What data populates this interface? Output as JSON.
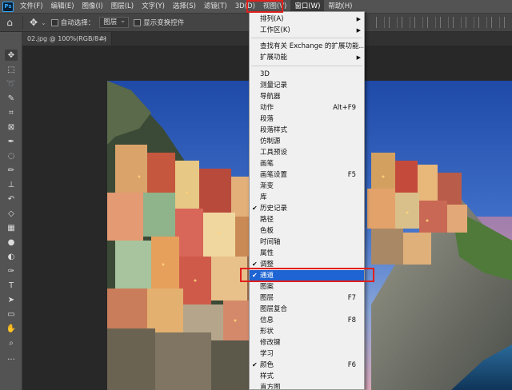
{
  "app": {
    "logo": "Ps"
  },
  "menubar": {
    "items": [
      "文件(F)",
      "编辑(E)",
      "图像(I)",
      "图层(L)",
      "文字(Y)",
      "选择(S)",
      "滤镜(T)",
      "3D(D)",
      "视图(V)",
      "窗口(W)",
      "帮助(H)"
    ]
  },
  "options": {
    "auto_select_label": "自动选择：",
    "auto_select_value": "图层",
    "show_transform_label": "显示变换控件"
  },
  "document": {
    "tab_title": "02.jpg @ 100%(RGB/8#)"
  },
  "window_menu": {
    "items": [
      {
        "label": "排列(A)",
        "submenu": true
      },
      {
        "label": "工作区(K)",
        "submenu": true
      },
      {
        "label": "查找有关 Exchange 的扩展功能..."
      },
      {
        "label": "扩展功能",
        "submenu": true
      },
      {
        "label": "3D"
      },
      {
        "label": "测量记录"
      },
      {
        "label": "导航器"
      },
      {
        "label": "动作",
        "shortcut": "Alt+F9"
      },
      {
        "label": "段落"
      },
      {
        "label": "段落样式"
      },
      {
        "label": "仿制源"
      },
      {
        "label": "工具预设"
      },
      {
        "label": "画笔"
      },
      {
        "label": "画笔设置",
        "shortcut": "F5"
      },
      {
        "label": "渐变"
      },
      {
        "label": "库"
      },
      {
        "label": "历史记录",
        "checked": true
      },
      {
        "label": "路径"
      },
      {
        "label": "色板"
      },
      {
        "label": "时间轴"
      },
      {
        "label": "属性"
      },
      {
        "label": "调整",
        "checked": true
      },
      {
        "label": "通道",
        "checked": true,
        "highlighted": true
      },
      {
        "label": "图案"
      },
      {
        "label": "图层",
        "shortcut": "F7"
      },
      {
        "label": "图层复合"
      },
      {
        "label": "信息",
        "shortcut": "F8"
      },
      {
        "label": "形状"
      },
      {
        "label": "修改键"
      },
      {
        "label": "学习"
      },
      {
        "label": "颜色",
        "checked": true,
        "shortcut": "F6"
      },
      {
        "label": "样式"
      },
      {
        "label": "直方图"
      }
    ]
  },
  "colors": {
    "highlight": "#1e64d2",
    "annotation": "#e0201c",
    "menubar": "#535353"
  }
}
